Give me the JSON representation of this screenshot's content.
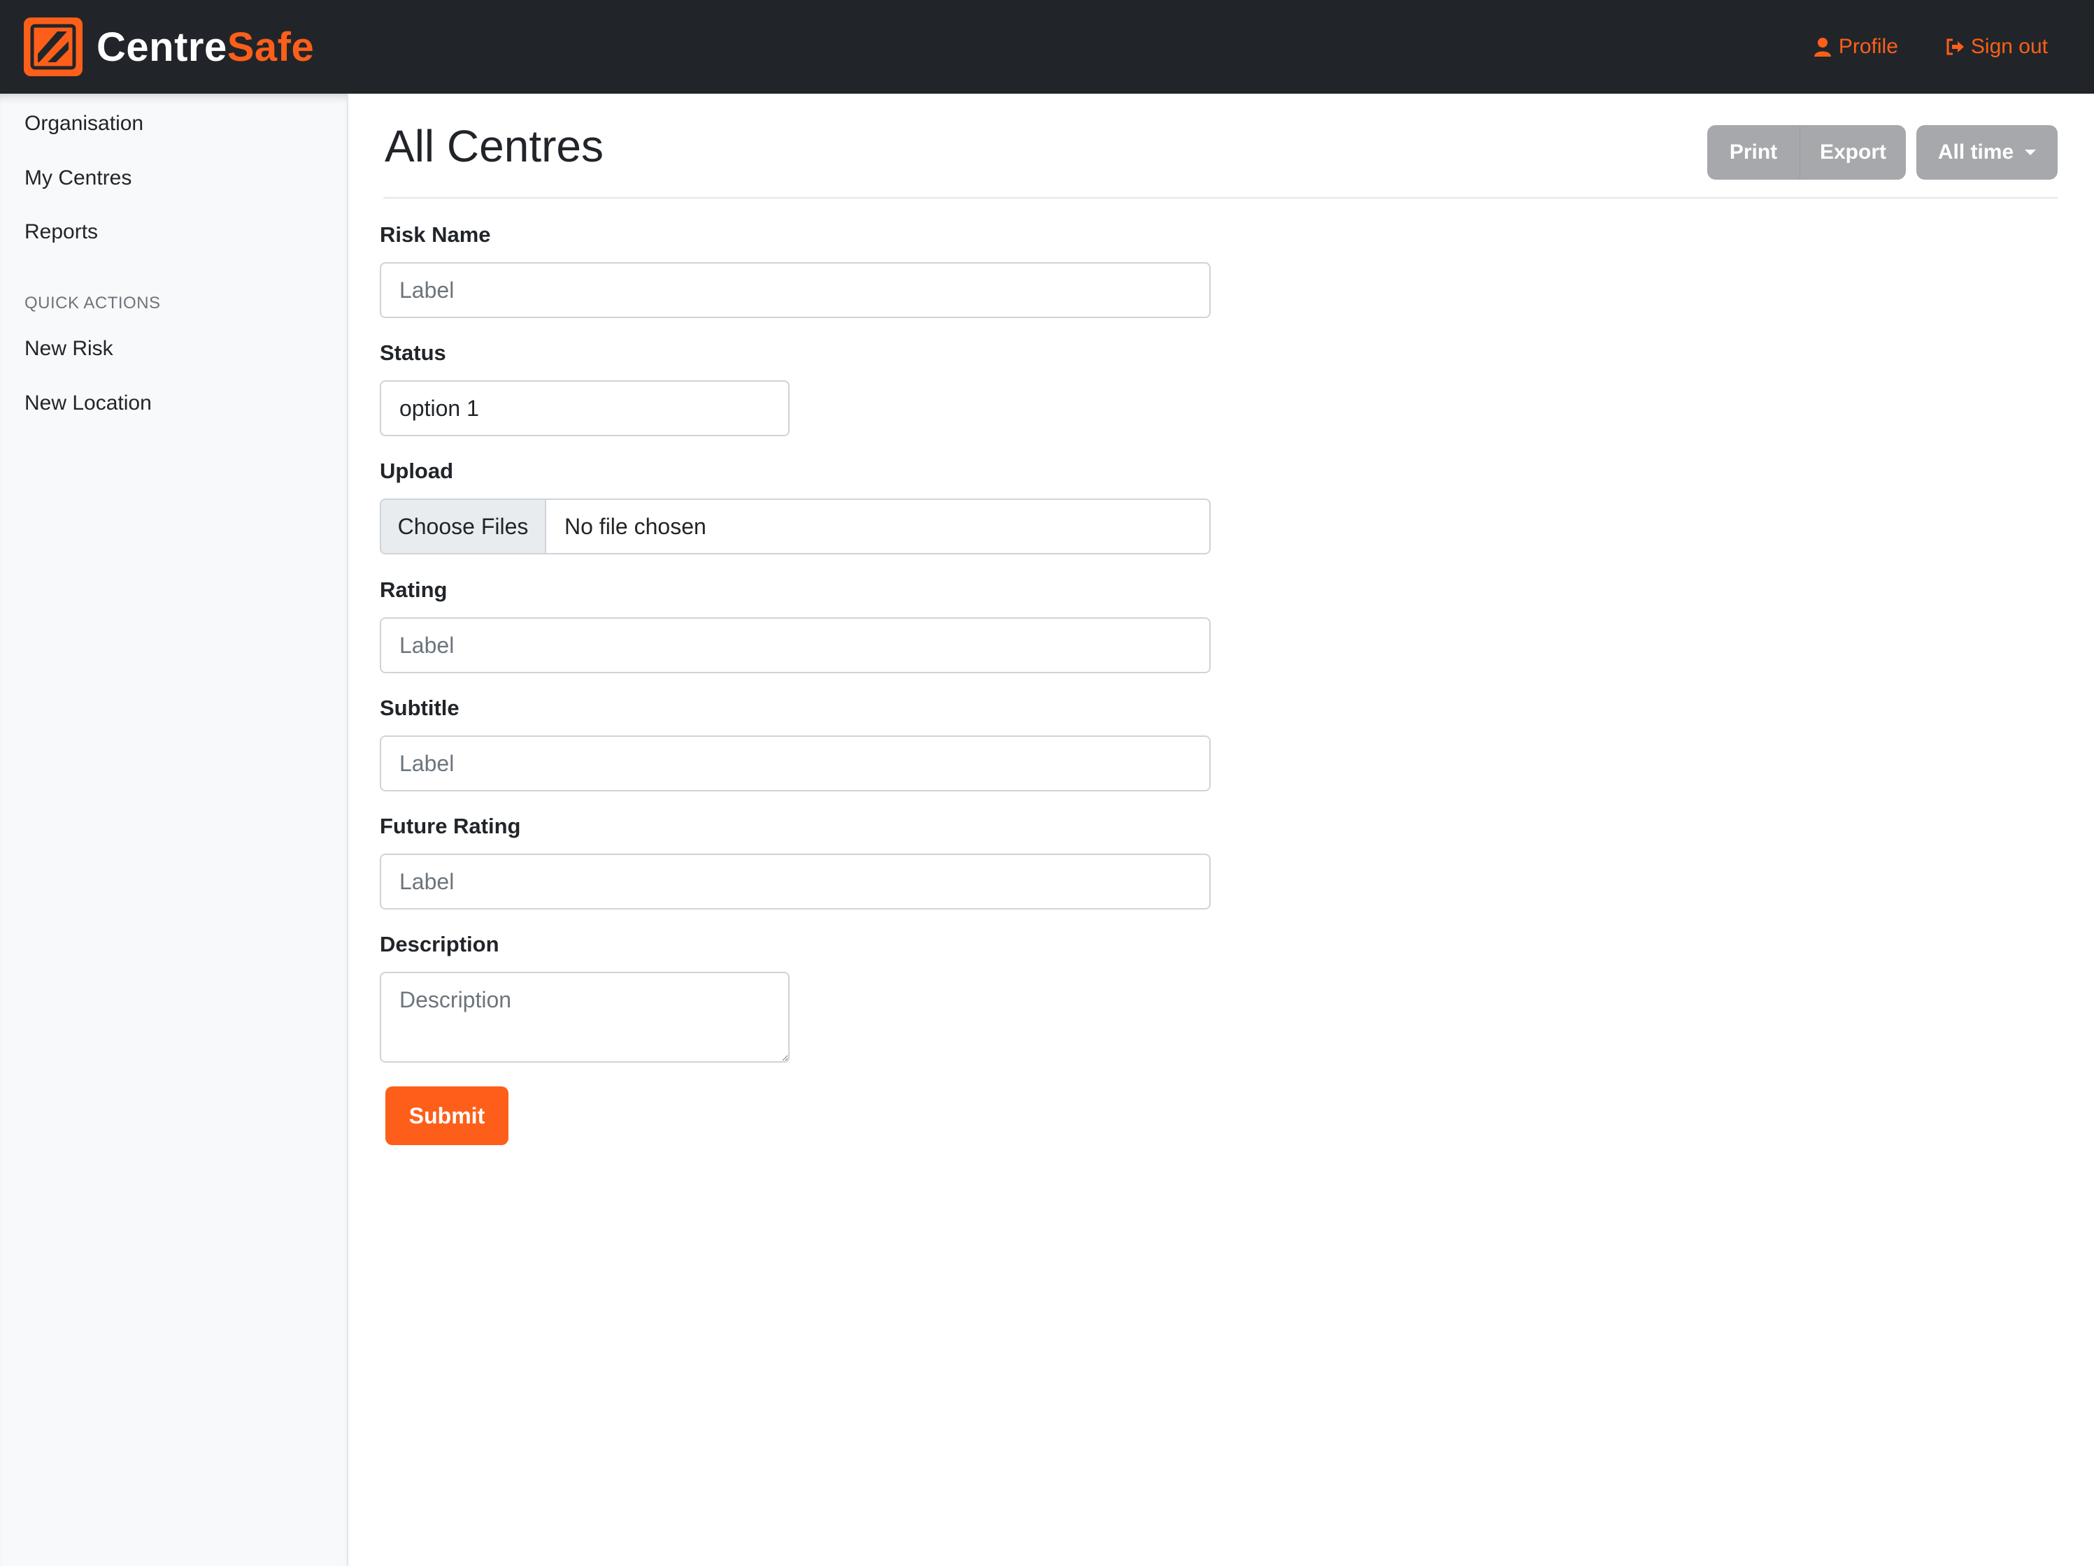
{
  "brand": {
    "name_part1": "Centre",
    "name_part2": "Safe",
    "accent_color": "#fd5f1a"
  },
  "header": {
    "profile_label": "Profile",
    "profile_icon": "user-icon",
    "signout_label": "Sign out",
    "signout_icon": "sign-out-icon"
  },
  "sidebar": {
    "items": [
      {
        "label": "Organisation"
      },
      {
        "label": "My Centres"
      },
      {
        "label": "Reports"
      }
    ],
    "quick_actions_heading": "QUICK ACTIONS",
    "quick_actions": [
      {
        "label": "New Risk"
      },
      {
        "label": "New Location"
      }
    ]
  },
  "main": {
    "title": "All Centres",
    "buttons": {
      "print": "Print",
      "export": "Export",
      "range": "All time"
    }
  },
  "form": {
    "risk_name": {
      "label": "Risk Name",
      "placeholder": "Label"
    },
    "status": {
      "label": "Status",
      "value": "option 1"
    },
    "upload": {
      "label": "Upload",
      "button": "Choose Files",
      "file_text": "No file chosen"
    },
    "rating": {
      "label": "Rating",
      "placeholder": "Label"
    },
    "subtitle": {
      "label": "Subtitle",
      "placeholder": "Label"
    },
    "future_rating": {
      "label": "Future Rating",
      "placeholder": "Label"
    },
    "description": {
      "label": "Description",
      "placeholder": "Description"
    },
    "submit": "Submit"
  }
}
